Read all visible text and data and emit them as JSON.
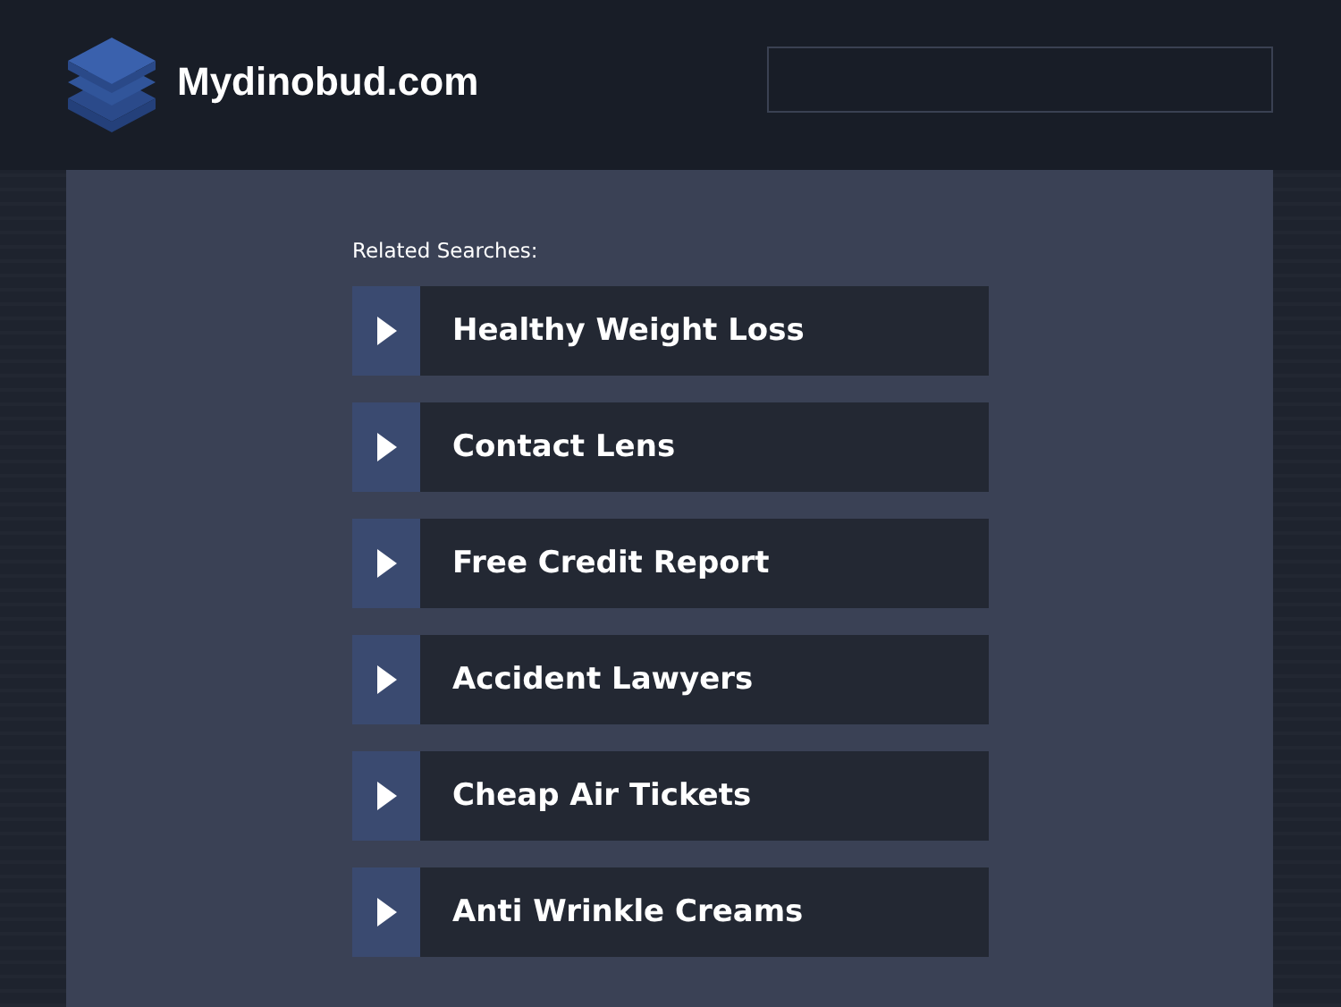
{
  "header": {
    "site_name": "Mydinobud.com"
  },
  "related": {
    "heading": "Related Searches:",
    "items": [
      {
        "label": "Healthy Weight Loss"
      },
      {
        "label": "Contact Lens"
      },
      {
        "label": "Free Credit Report"
      },
      {
        "label": "Accident Lawyers"
      },
      {
        "label": "Cheap Air Tickets"
      },
      {
        "label": "Anti Wrinkle Creams"
      }
    ]
  }
}
